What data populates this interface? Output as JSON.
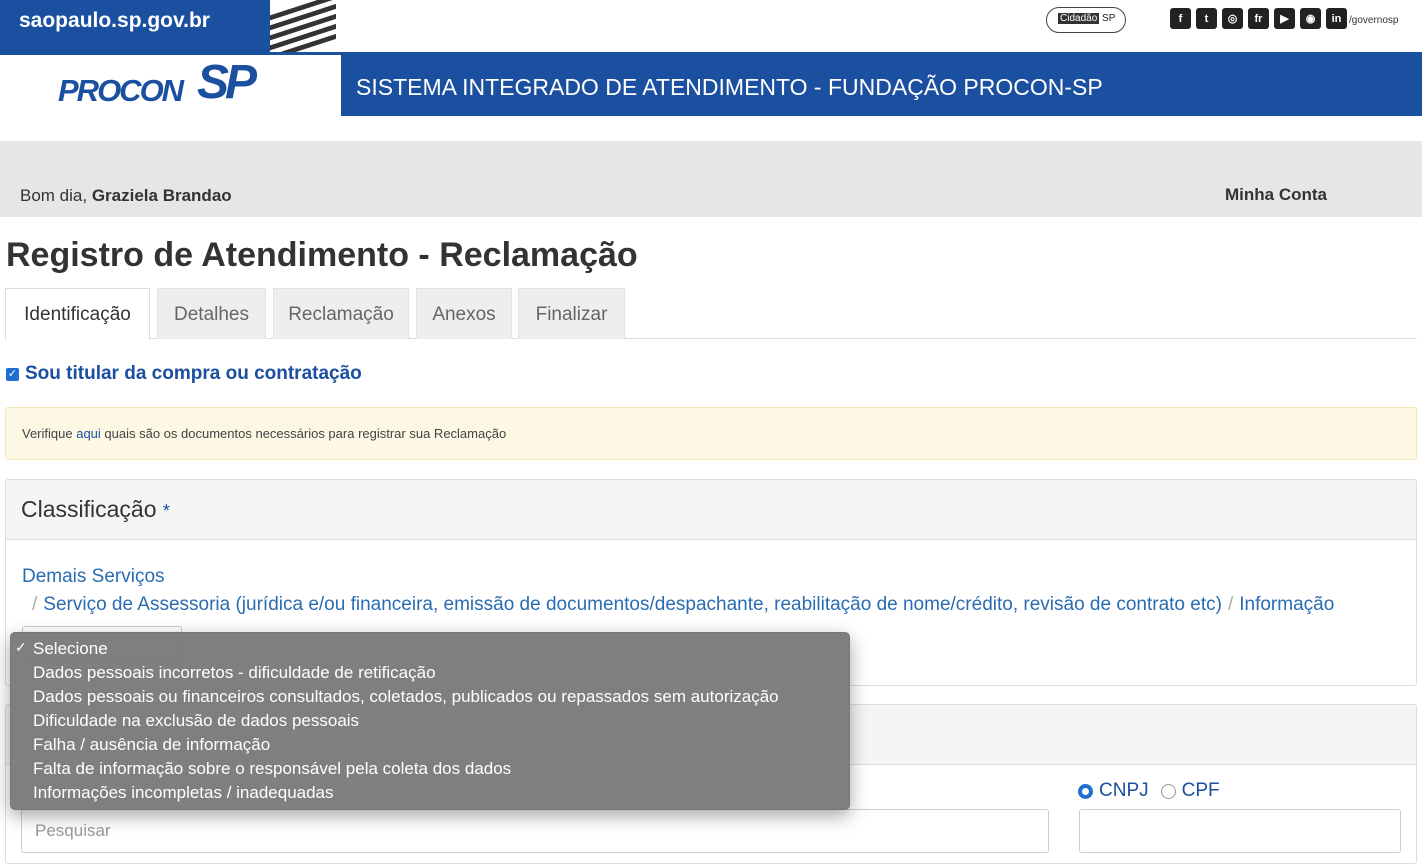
{
  "gov": {
    "brand": "saopaulo.sp.gov.br",
    "cidadao_a": "Cidadão",
    "cidadao_b": "SP",
    "social": [
      "f",
      "t",
      "◎",
      "fr",
      "▶",
      "◉",
      "in"
    ],
    "social_icons": [
      "facebook-icon",
      "twitter-icon",
      "instagram-icon",
      "flickr-icon",
      "youtube-icon",
      "periscope-icon",
      "linkedin-icon"
    ],
    "handle": "/governosp"
  },
  "header": {
    "logo_a": "PROCON",
    "logo_b": "SP",
    "system_title": "SISTEMA INTEGRADO DE ATENDIMENTO - FUNDAÇÃO PROCON-SP"
  },
  "greeting": {
    "prefix": "Bom dia,",
    "user": "Graziela Brandao",
    "account": "Minha Conta"
  },
  "page_title": "Registro de Atendimento - Reclamação",
  "tabs": [
    {
      "label": "Identificação",
      "active": true
    },
    {
      "label": "Detalhes"
    },
    {
      "label": "Reclamação"
    },
    {
      "label": "Anexos"
    },
    {
      "label": "Finalizar"
    }
  ],
  "titular_label": "Sou titular da compra ou contratação",
  "alert": {
    "prefix": "Verifique",
    "link": "aqui",
    "suffix": "quais são os documentos necessários para registrar sua Reclamação"
  },
  "classification": {
    "title": "Classificação",
    "required_mark": "*",
    "crumb1": "Demais Serviços",
    "crumb2": "Serviço de Assessoria (jurídica e/ou financeira, emissão de documentos/despachante, reabilitação de nome/crédito, revisão de contrato etc)",
    "crumb3": "Informação",
    "separator": "/"
  },
  "dropdown": {
    "options": [
      "Selecione",
      "Dados pessoais incorretos - dificuldade de retificação",
      "Dados pessoais ou financeiros consultados, coletados, publicados ou repassados sem autorização",
      "Dificuldade na exclusão de dados pessoais",
      "Falha / ausência de informação",
      "Falta de informação sobre o responsável pela coleta dos dados",
      "Informações incompletas / inadequadas"
    ],
    "selected_index": 0,
    "check_mark": "✓"
  },
  "supplier": {
    "cnpj": "CNPJ",
    "cpf": "CPF",
    "search_placeholder": "Pesquisar"
  }
}
